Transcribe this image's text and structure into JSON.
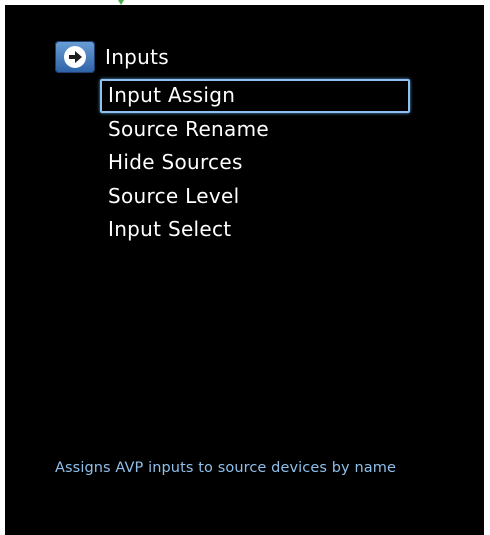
{
  "menu": {
    "title": "Inputs",
    "icon": "arrow-right-circle-icon",
    "items": [
      {
        "label": "Input Assign",
        "selected": true
      },
      {
        "label": "Source Rename",
        "selected": false
      },
      {
        "label": "Hide Sources",
        "selected": false
      },
      {
        "label": "Source Level",
        "selected": false
      },
      {
        "label": "Input Select",
        "selected": false
      }
    ]
  },
  "help": {
    "text": "Assigns AVP inputs to source devices by name"
  },
  "colors": {
    "background": "#000000",
    "text": "#ffffff",
    "selection_border": "#8ec0f0",
    "help_text": "#8fbfea",
    "icon_fill": "#3d74bd"
  }
}
